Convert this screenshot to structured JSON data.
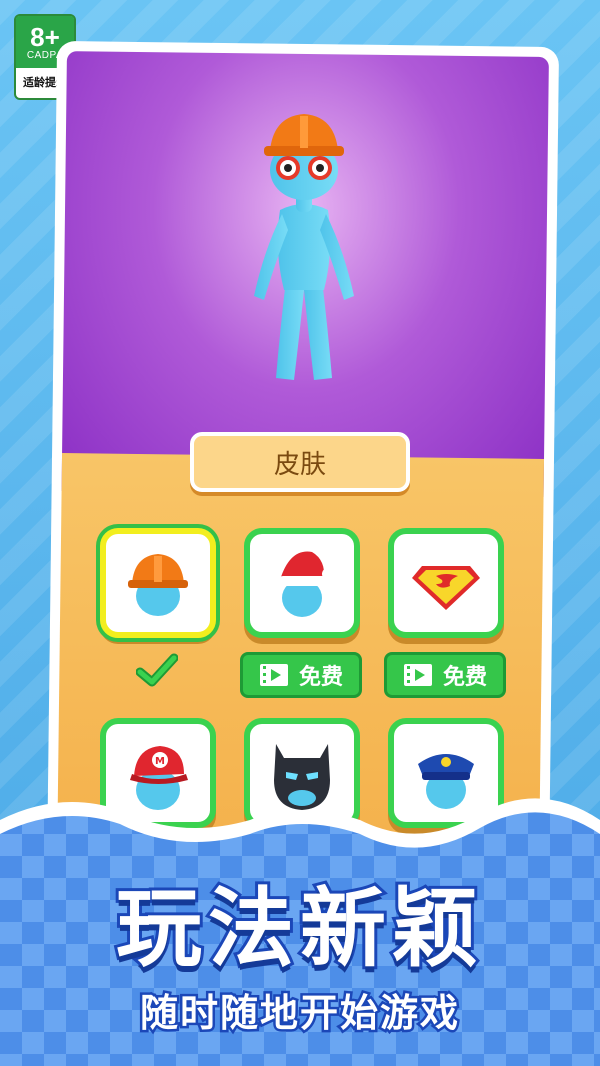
{
  "age_rating": {
    "number": "8+",
    "org": "CADPA",
    "tip": "适龄提示"
  },
  "skin_panel": {
    "title": "皮肤"
  },
  "items": [
    {
      "name": "hard-hat",
      "status": "selected"
    },
    {
      "name": "santa-hat",
      "button": "免费"
    },
    {
      "name": "superman-logo",
      "button": "免费"
    },
    {
      "name": "mario-cap"
    },
    {
      "name": "batman-mask"
    },
    {
      "name": "police-cap"
    }
  ],
  "banner": {
    "headline": "玩法新颖",
    "subline": "随时随地开始游戏"
  },
  "colors": {
    "accent_green": "#35c64a",
    "stage_purple": "#a64ad0",
    "panel_orange": "#f6ba55",
    "outline_blue": "#1b47b8"
  }
}
